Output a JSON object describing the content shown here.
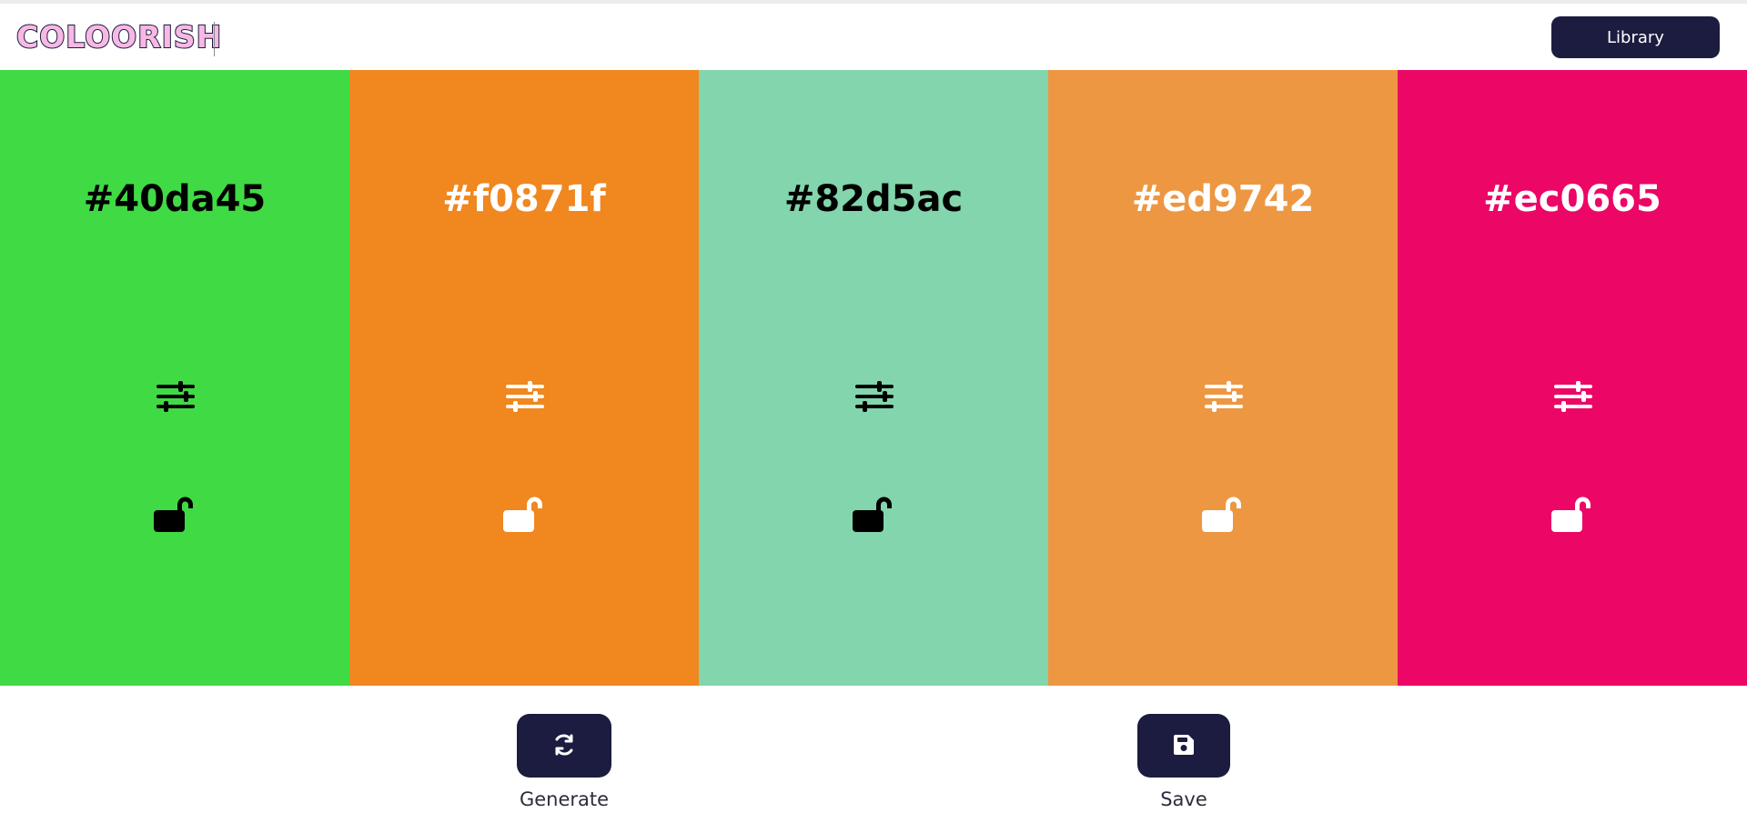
{
  "header": {
    "logo_text": "COLOORISH",
    "library_label": "Library"
  },
  "palette": [
    {
      "hex": "#40da45",
      "bg": "#40da45",
      "fg": "#000000",
      "adjust_icon": "sliders-icon",
      "lock_icon": "unlock-icon"
    },
    {
      "hex": "#f0871f",
      "bg": "#f0871f",
      "fg": "#ffffff",
      "adjust_icon": "sliders-icon",
      "lock_icon": "unlock-icon"
    },
    {
      "hex": "#82d5ac",
      "bg": "#82d5ac",
      "fg": "#000000",
      "adjust_icon": "sliders-icon",
      "lock_icon": "unlock-icon"
    },
    {
      "hex": "#ed9742",
      "bg": "#ed9742",
      "fg": "#ffffff",
      "adjust_icon": "sliders-icon",
      "lock_icon": "unlock-icon"
    },
    {
      "hex": "#ec0665",
      "bg": "#ec0665",
      "fg": "#ffffff",
      "adjust_icon": "sliders-icon",
      "lock_icon": "unlock-icon"
    }
  ],
  "actions": {
    "generate": {
      "label": "Generate",
      "icon": "refresh-icon"
    },
    "save": {
      "label": "Save",
      "icon": "floppy-disk-icon"
    }
  },
  "colors": {
    "brand_dark": "#1b1c3f",
    "logo_fill": "#f7b9e4"
  }
}
